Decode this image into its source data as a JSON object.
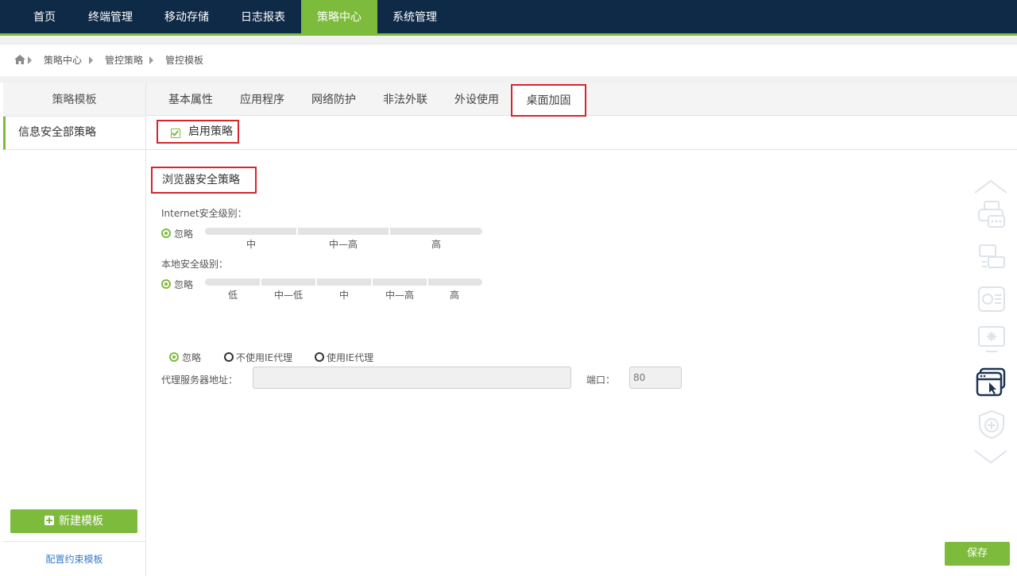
{
  "topnav": {
    "items": [
      {
        "label": "首页"
      },
      {
        "label": "终端管理"
      },
      {
        "label": "移动存储"
      },
      {
        "label": "日志报表"
      },
      {
        "label": "策略中心"
      },
      {
        "label": "系统管理"
      }
    ],
    "active_index": 4
  },
  "breadcrumb": {
    "home_icon": "home-icon",
    "items": [
      "策略中心",
      "管控策略",
      "管控模板"
    ]
  },
  "sidebar": {
    "header": "策略模板",
    "templates": [
      "信息安全部策略"
    ],
    "new_button": "新建模板",
    "config_link": "配置约束模板"
  },
  "tabs": {
    "items": [
      "基本属性",
      "应用程序",
      "网络防护",
      "非法外联",
      "外设使用",
      "桌面加固"
    ],
    "active": "桌面加固"
  },
  "enable": {
    "label": "启用策略",
    "checked": true
  },
  "browser": {
    "title": "浏览器安全策略",
    "internet": {
      "label": "Internet安全级别：",
      "ignore_label": "忽略",
      "ignore_selected": true,
      "levels": [
        "中",
        "中—高",
        "高"
      ]
    },
    "local": {
      "label": "本地安全级别：",
      "ignore_label": "忽略",
      "ignore_selected": true,
      "levels": [
        "低",
        "中—低",
        "中",
        "中—高",
        "高"
      ]
    },
    "proxy": {
      "options": [
        "忽略",
        "不使用IE代理",
        "使用IE代理"
      ],
      "selected": "忽略",
      "address_label": "代理服务器地址：",
      "address_value": "",
      "port_label": "端口：",
      "port_value": "80"
    }
  },
  "save_button": "保存",
  "colors": {
    "nav_bg": "#0f2a47",
    "accent": "#7dbb3c",
    "highlight": "#d9242b",
    "link": "#3a7bc8"
  },
  "rail_icons": [
    "chevron-up-icon",
    "printer-icon",
    "devices-icon",
    "gear-list-icon",
    "monitor-sparkle-icon",
    "window-cursor-icon",
    "shield-plus-icon",
    "chevron-down-icon"
  ]
}
